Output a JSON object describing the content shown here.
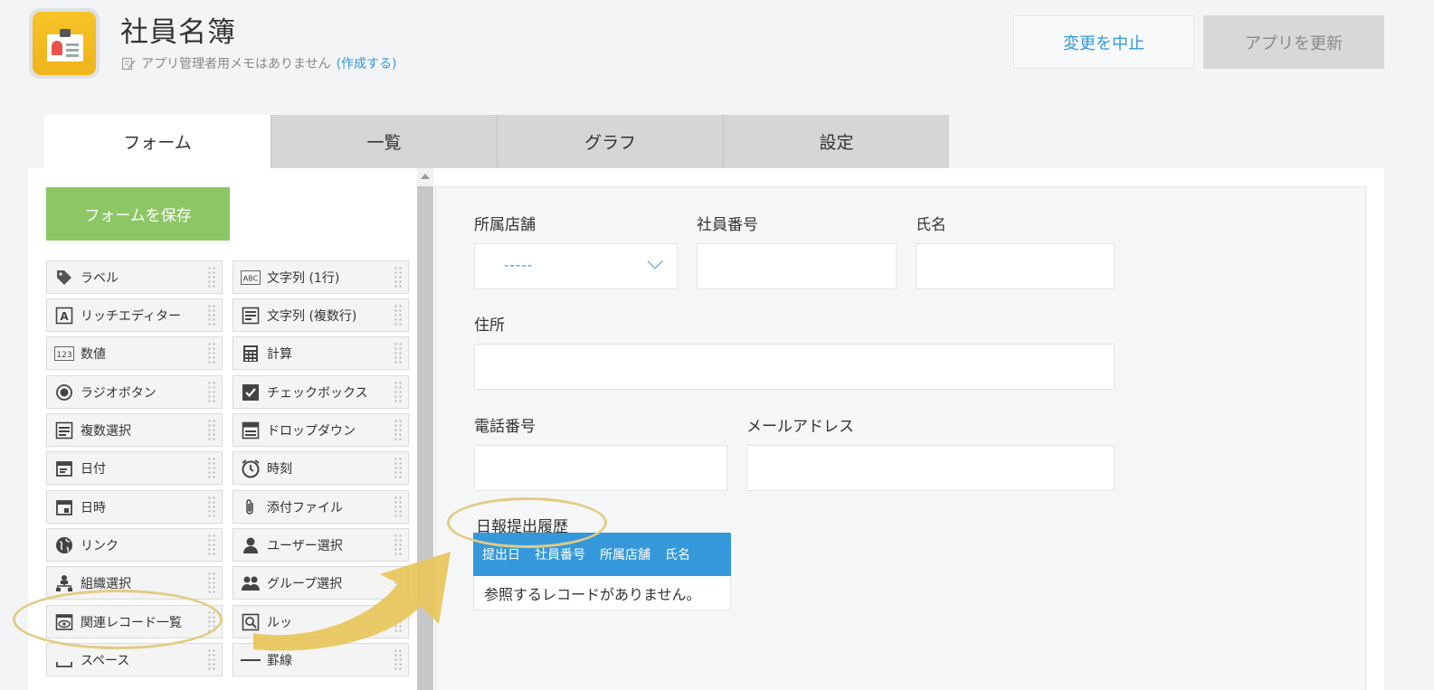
{
  "header": {
    "app_title": "社員名簿",
    "memo_text": "アプリ管理者用メモはありません",
    "memo_link": "(作成する)",
    "cancel_label": "変更を中止",
    "update_label": "アプリを更新"
  },
  "tabs": [
    {
      "label": "フォーム",
      "active": true
    },
    {
      "label": "一覧",
      "active": false
    },
    {
      "label": "グラフ",
      "active": false
    },
    {
      "label": "設定",
      "active": false
    }
  ],
  "palette": {
    "save_label": "フォームを保存",
    "items": [
      {
        "label": "ラベル",
        "icon": "tag-icon"
      },
      {
        "label": "文字列 (1行)",
        "icon": "abc-icon"
      },
      {
        "label": "リッチエディター",
        "icon": "rich-text-icon"
      },
      {
        "label": "文字列 (複数行)",
        "icon": "multiline-text-icon"
      },
      {
        "label": "数値",
        "icon": "number-123-icon"
      },
      {
        "label": "計算",
        "icon": "calculator-icon"
      },
      {
        "label": "ラジオボタン",
        "icon": "radio-icon"
      },
      {
        "label": "チェックボックス",
        "icon": "checkbox-icon"
      },
      {
        "label": "複数選択",
        "icon": "multi-select-icon"
      },
      {
        "label": "ドロップダウン",
        "icon": "dropdown-icon"
      },
      {
        "label": "日付",
        "icon": "calendar-icon"
      },
      {
        "label": "時刻",
        "icon": "clock-icon"
      },
      {
        "label": "日時",
        "icon": "datetime-icon"
      },
      {
        "label": "添付ファイル",
        "icon": "paperclip-icon"
      },
      {
        "label": "リンク",
        "icon": "globe-icon"
      },
      {
        "label": "ユーザー選択",
        "icon": "user-icon"
      },
      {
        "label": "組織選択",
        "icon": "org-icon"
      },
      {
        "label": "グループ選択",
        "icon": "group-icon"
      },
      {
        "label": "関連レコード一覧",
        "icon": "related-records-icon"
      },
      {
        "label": "ルッ",
        "icon": "lookup-icon"
      },
      {
        "label": "スペース",
        "icon": "space-icon"
      },
      {
        "label": "罫線",
        "icon": "line-icon"
      }
    ]
  },
  "form": {
    "store_label": "所属店舗",
    "store_value": "-----",
    "employee_no_label": "社員番号",
    "name_label": "氏名",
    "address_label": "住所",
    "phone_label": "電話番号",
    "email_label": "メールアドレス",
    "history_label": "日報提出履歴",
    "history_columns": [
      "提出日",
      "社員番号",
      "所属店舗",
      "氏名"
    ],
    "history_empty": "参照するレコードがありません。"
  },
  "colors": {
    "accent": "#3498db",
    "save_green": "#8dc765",
    "annotation": "#e3cb84",
    "app_icon": "#f7c326"
  }
}
